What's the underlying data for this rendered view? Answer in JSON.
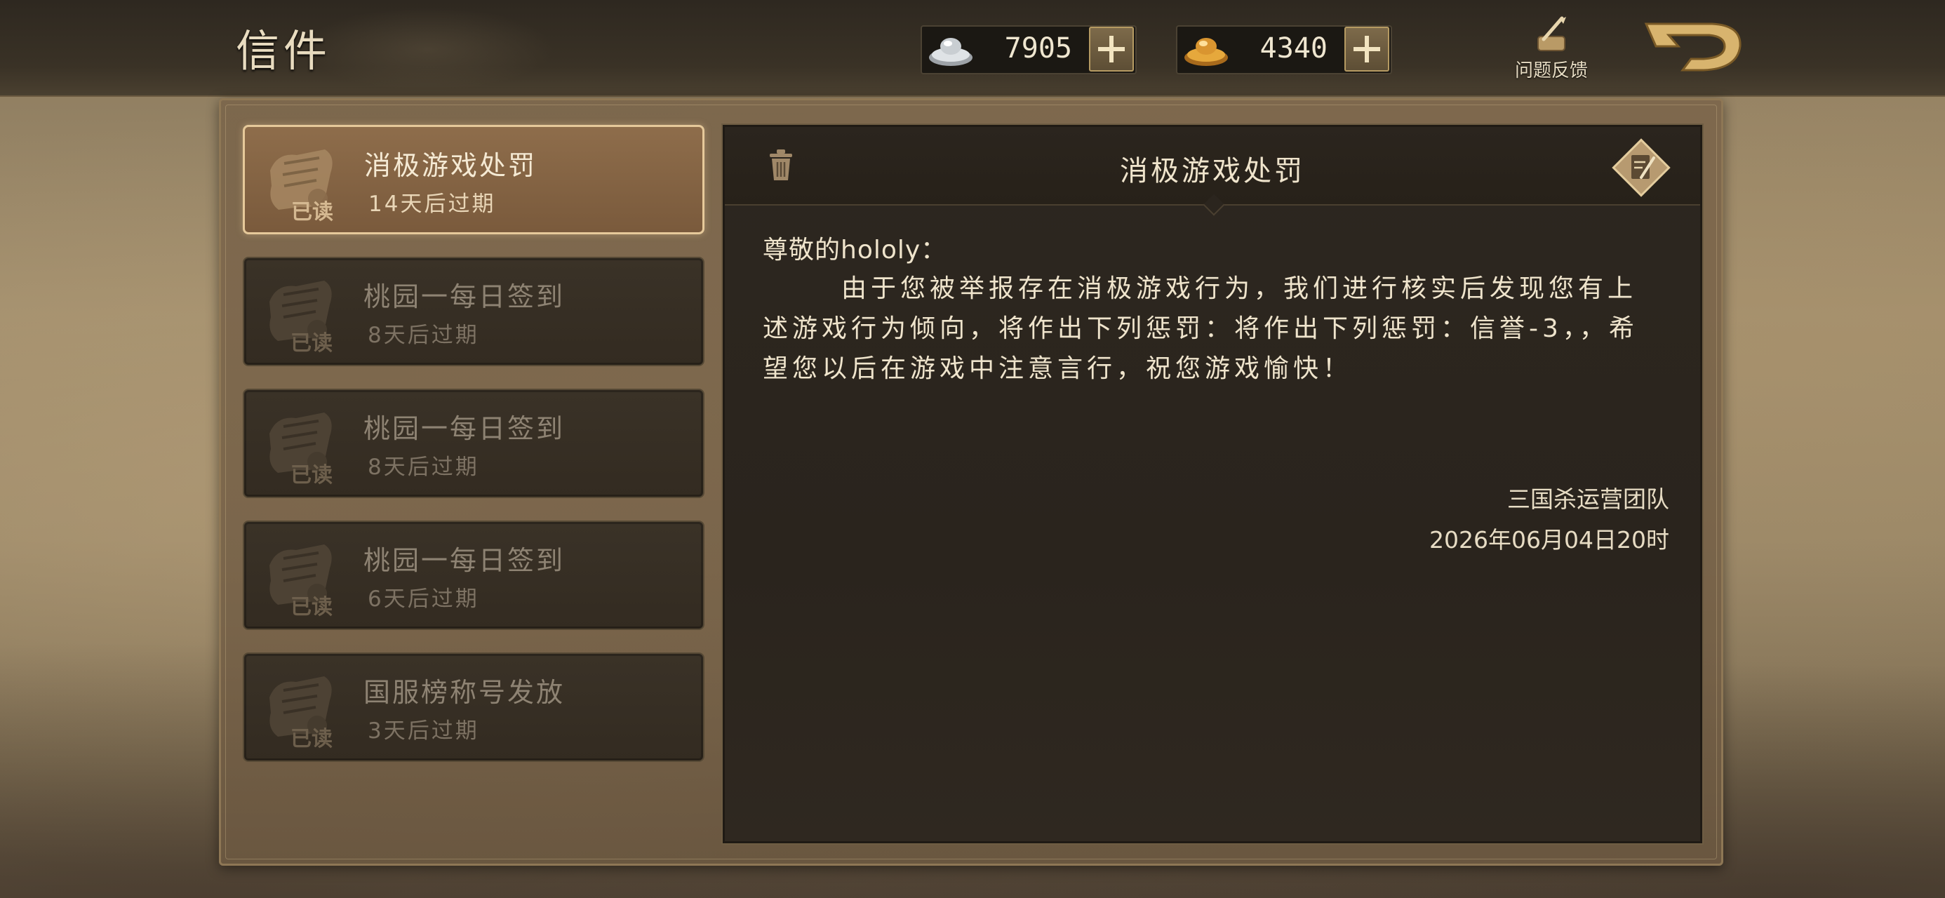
{
  "header": {
    "title": "信件",
    "silver": {
      "icon": "silver-ingot-icon",
      "amount": "7905"
    },
    "gold": {
      "icon": "gold-ingot-icon",
      "amount": "4340"
    },
    "feedback_label": "问题反馈"
  },
  "mail_list": [
    {
      "title": "消极游戏处罚",
      "expiry": "14天后过期",
      "read_tag": "已读",
      "selected": true
    },
    {
      "title": "桃园一每日签到",
      "expiry": "8天后过期",
      "read_tag": "已读",
      "selected": false
    },
    {
      "title": "桃园一每日签到",
      "expiry": "8天后过期",
      "read_tag": "已读",
      "selected": false
    },
    {
      "title": "桃园一每日签到",
      "expiry": "6天后过期",
      "read_tag": "已读",
      "selected": false
    },
    {
      "title": "国服榜称号发放",
      "expiry": "3天后过期",
      "read_tag": "已读",
      "selected": false
    }
  ],
  "detail": {
    "title": "消极游戏处罚",
    "greeting": "尊敬的hololy：",
    "body": "由于您被举报存在消极游戏行为，我们进行核实后发现您有上述游戏行为倾向，将作出下列惩罚：将作出下列惩罚：信誉-3，，希望您以后在游戏中注意言行，祝您游戏愉快！",
    "signature": "三国杀运营团队",
    "date": "2026年06月04日20时"
  },
  "colors": {
    "accent_gold": "#e6c99a",
    "panel_dark": "#2d2720",
    "text_light": "#efe4cc"
  }
}
